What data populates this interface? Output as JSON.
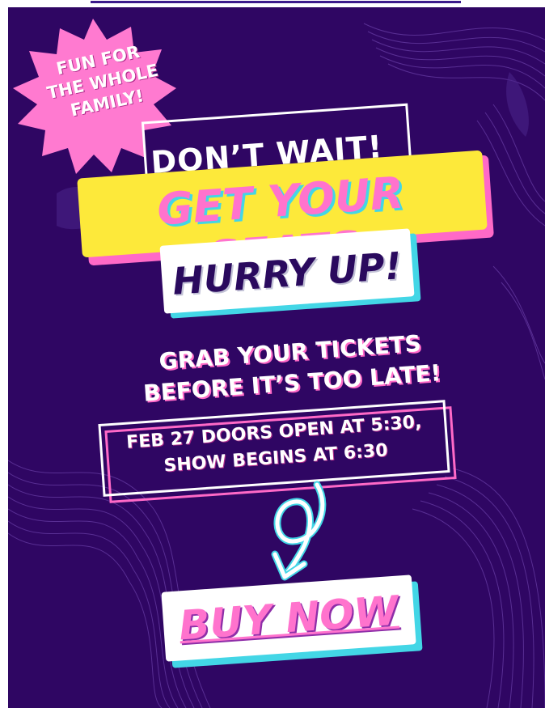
{
  "colors": {
    "background": "#2f0663",
    "pink": "#ff69c7",
    "yellow": "#fde93a",
    "cyan": "#43d6e6",
    "white": "#ffffff",
    "dark_purple_text": "#2a0a5e"
  },
  "burst": {
    "icon": "starburst-badge-icon",
    "lines": [
      "FUN FOR",
      "THE WHOLE",
      "FAMILY!"
    ]
  },
  "headline": {
    "dont_wait": "DON’T WAIT!",
    "get_seats": "GET YOUR SEATS",
    "hurry_up": "HURRY UP!"
  },
  "tagline": {
    "lines": [
      "GRAB YOUR TICKETS",
      "BEFORE IT’S TOO LATE!"
    ]
  },
  "event_info": {
    "lines": [
      "FEB 27 DOORS OPEN AT 5:30,",
      "SHOW BEGINS AT 6:30"
    ]
  },
  "arrow": {
    "icon": "curly-arrow-down-icon"
  },
  "cta": {
    "label": "BUY NOW"
  }
}
